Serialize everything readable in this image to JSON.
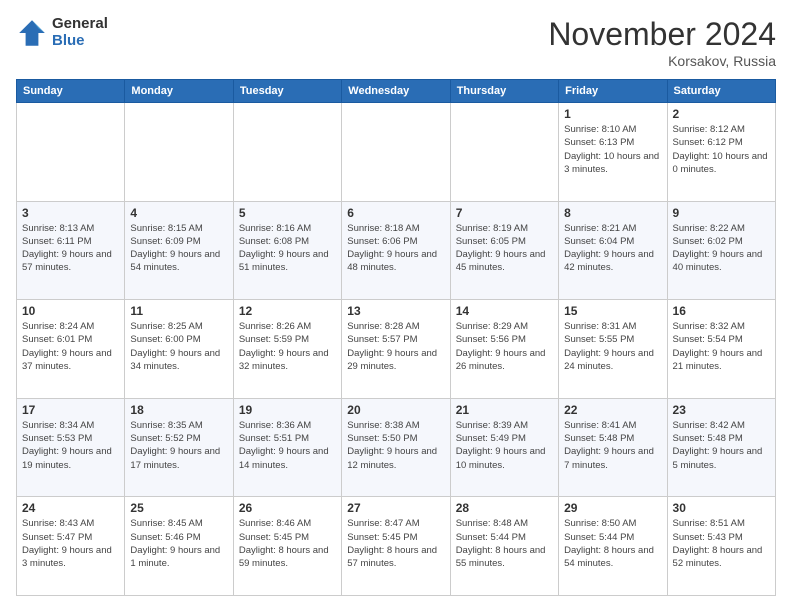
{
  "logo": {
    "general": "General",
    "blue": "Blue"
  },
  "title": "November 2024",
  "location": "Korsakov, Russia",
  "days_of_week": [
    "Sunday",
    "Monday",
    "Tuesday",
    "Wednesday",
    "Thursday",
    "Friday",
    "Saturday"
  ],
  "weeks": [
    [
      {
        "day": "",
        "info": ""
      },
      {
        "day": "",
        "info": ""
      },
      {
        "day": "",
        "info": ""
      },
      {
        "day": "",
        "info": ""
      },
      {
        "day": "",
        "info": ""
      },
      {
        "day": "1",
        "info": "Sunrise: 8:10 AM\nSunset: 6:13 PM\nDaylight: 10 hours and 3 minutes."
      },
      {
        "day": "2",
        "info": "Sunrise: 8:12 AM\nSunset: 6:12 PM\nDaylight: 10 hours and 0 minutes."
      }
    ],
    [
      {
        "day": "3",
        "info": "Sunrise: 8:13 AM\nSunset: 6:11 PM\nDaylight: 9 hours and 57 minutes."
      },
      {
        "day": "4",
        "info": "Sunrise: 8:15 AM\nSunset: 6:09 PM\nDaylight: 9 hours and 54 minutes."
      },
      {
        "day": "5",
        "info": "Sunrise: 8:16 AM\nSunset: 6:08 PM\nDaylight: 9 hours and 51 minutes."
      },
      {
        "day": "6",
        "info": "Sunrise: 8:18 AM\nSunset: 6:06 PM\nDaylight: 9 hours and 48 minutes."
      },
      {
        "day": "7",
        "info": "Sunrise: 8:19 AM\nSunset: 6:05 PM\nDaylight: 9 hours and 45 minutes."
      },
      {
        "day": "8",
        "info": "Sunrise: 8:21 AM\nSunset: 6:04 PM\nDaylight: 9 hours and 42 minutes."
      },
      {
        "day": "9",
        "info": "Sunrise: 8:22 AM\nSunset: 6:02 PM\nDaylight: 9 hours and 40 minutes."
      }
    ],
    [
      {
        "day": "10",
        "info": "Sunrise: 8:24 AM\nSunset: 6:01 PM\nDaylight: 9 hours and 37 minutes."
      },
      {
        "day": "11",
        "info": "Sunrise: 8:25 AM\nSunset: 6:00 PM\nDaylight: 9 hours and 34 minutes."
      },
      {
        "day": "12",
        "info": "Sunrise: 8:26 AM\nSunset: 5:59 PM\nDaylight: 9 hours and 32 minutes."
      },
      {
        "day": "13",
        "info": "Sunrise: 8:28 AM\nSunset: 5:57 PM\nDaylight: 9 hours and 29 minutes."
      },
      {
        "day": "14",
        "info": "Sunrise: 8:29 AM\nSunset: 5:56 PM\nDaylight: 9 hours and 26 minutes."
      },
      {
        "day": "15",
        "info": "Sunrise: 8:31 AM\nSunset: 5:55 PM\nDaylight: 9 hours and 24 minutes."
      },
      {
        "day": "16",
        "info": "Sunrise: 8:32 AM\nSunset: 5:54 PM\nDaylight: 9 hours and 21 minutes."
      }
    ],
    [
      {
        "day": "17",
        "info": "Sunrise: 8:34 AM\nSunset: 5:53 PM\nDaylight: 9 hours and 19 minutes."
      },
      {
        "day": "18",
        "info": "Sunrise: 8:35 AM\nSunset: 5:52 PM\nDaylight: 9 hours and 17 minutes."
      },
      {
        "day": "19",
        "info": "Sunrise: 8:36 AM\nSunset: 5:51 PM\nDaylight: 9 hours and 14 minutes."
      },
      {
        "day": "20",
        "info": "Sunrise: 8:38 AM\nSunset: 5:50 PM\nDaylight: 9 hours and 12 minutes."
      },
      {
        "day": "21",
        "info": "Sunrise: 8:39 AM\nSunset: 5:49 PM\nDaylight: 9 hours and 10 minutes."
      },
      {
        "day": "22",
        "info": "Sunrise: 8:41 AM\nSunset: 5:48 PM\nDaylight: 9 hours and 7 minutes."
      },
      {
        "day": "23",
        "info": "Sunrise: 8:42 AM\nSunset: 5:48 PM\nDaylight: 9 hours and 5 minutes."
      }
    ],
    [
      {
        "day": "24",
        "info": "Sunrise: 8:43 AM\nSunset: 5:47 PM\nDaylight: 9 hours and 3 minutes."
      },
      {
        "day": "25",
        "info": "Sunrise: 8:45 AM\nSunset: 5:46 PM\nDaylight: 9 hours and 1 minute."
      },
      {
        "day": "26",
        "info": "Sunrise: 8:46 AM\nSunset: 5:45 PM\nDaylight: 8 hours and 59 minutes."
      },
      {
        "day": "27",
        "info": "Sunrise: 8:47 AM\nSunset: 5:45 PM\nDaylight: 8 hours and 57 minutes."
      },
      {
        "day": "28",
        "info": "Sunrise: 8:48 AM\nSunset: 5:44 PM\nDaylight: 8 hours and 55 minutes."
      },
      {
        "day": "29",
        "info": "Sunrise: 8:50 AM\nSunset: 5:44 PM\nDaylight: 8 hours and 54 minutes."
      },
      {
        "day": "30",
        "info": "Sunrise: 8:51 AM\nSunset: 5:43 PM\nDaylight: 8 hours and 52 minutes."
      }
    ]
  ]
}
